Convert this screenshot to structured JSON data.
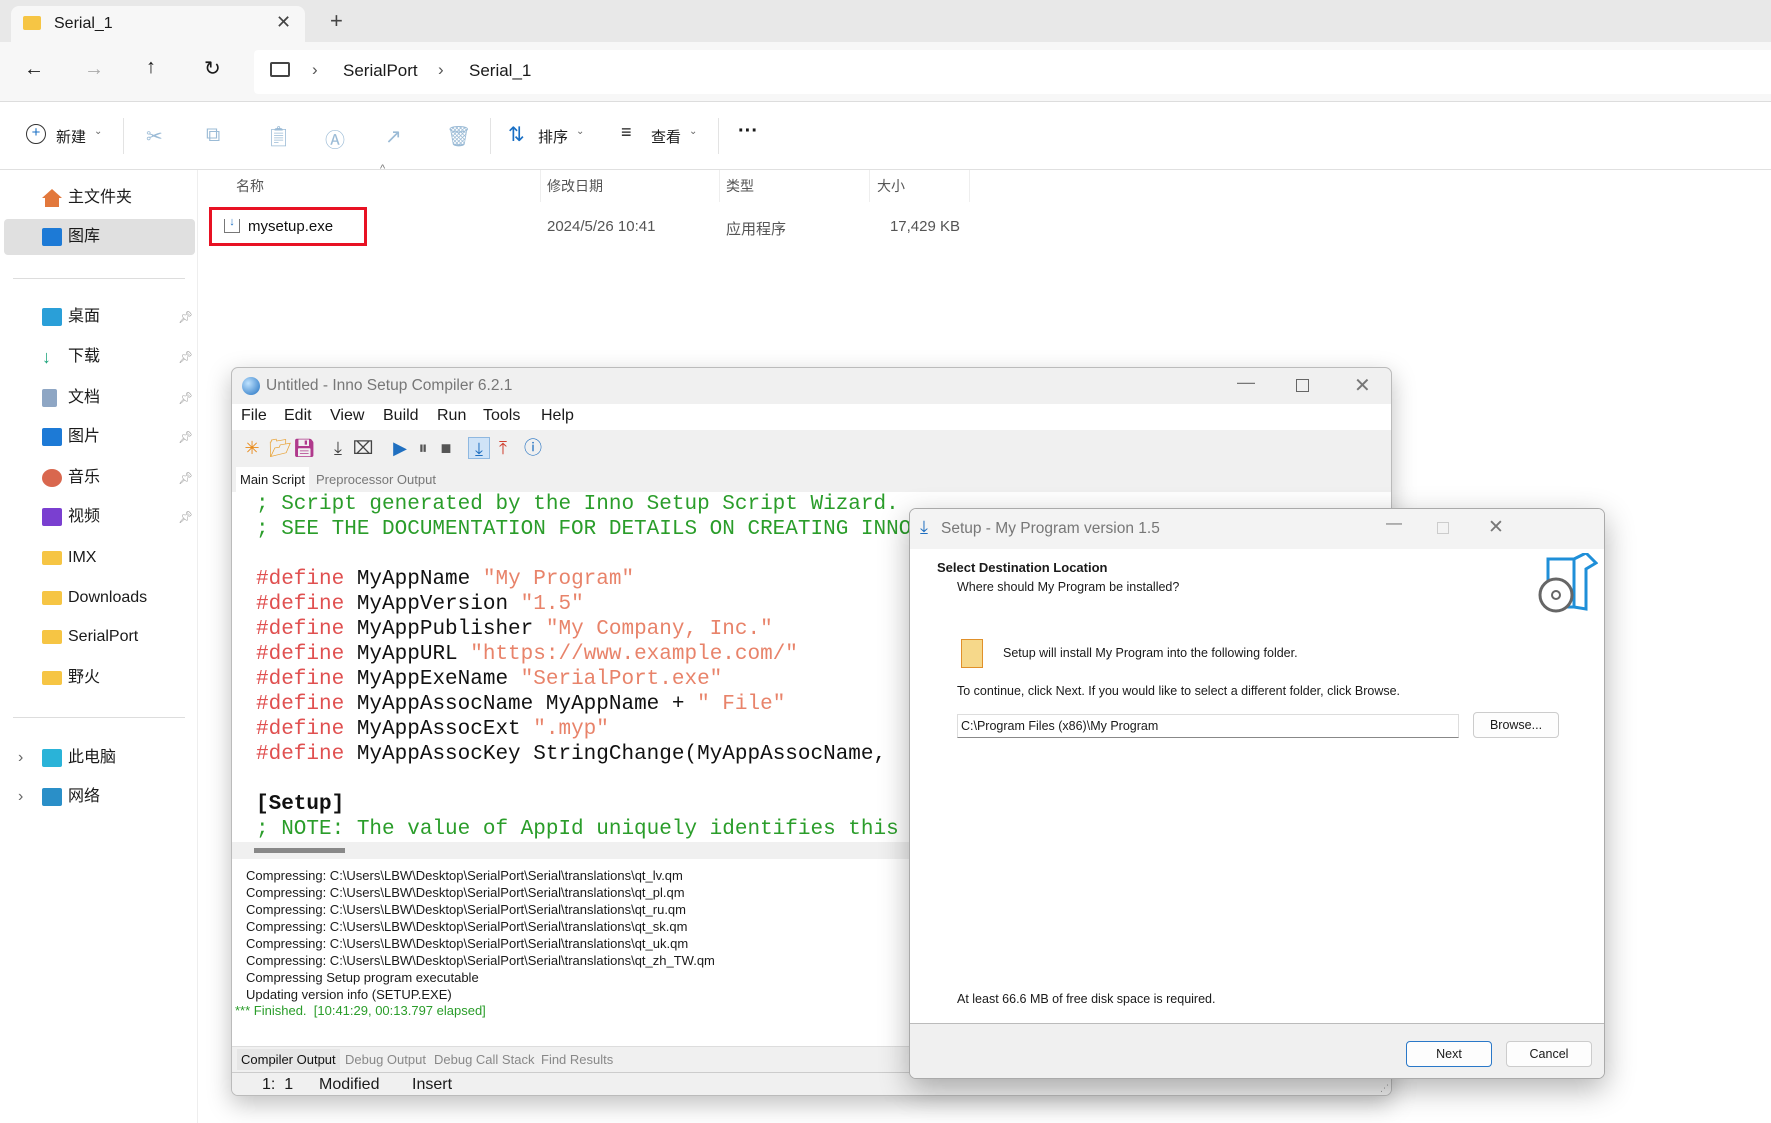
{
  "explorer": {
    "tab_title": "Serial_1",
    "breadcrumb": [
      "SerialPort",
      "Serial_1"
    ],
    "toolbar": {
      "new": "新建",
      "sort": "排序",
      "view": "查看",
      "more": "···"
    },
    "sidebar": {
      "top": [
        {
          "label": "主文件夹",
          "icon": "home-icon"
        },
        {
          "label": "图库",
          "icon": "gallery-icon",
          "selected": true
        }
      ],
      "quick": [
        {
          "label": "桌面",
          "icon": "desktop-icon",
          "pinned": true
        },
        {
          "label": "下载",
          "icon": "download-icon",
          "pinned": true
        },
        {
          "label": "文档",
          "icon": "documents-icon",
          "pinned": true
        },
        {
          "label": "图片",
          "icon": "pictures-icon",
          "pinned": true
        },
        {
          "label": "音乐",
          "icon": "music-icon",
          "pinned": true
        },
        {
          "label": "视频",
          "icon": "videos-icon",
          "pinned": true
        },
        {
          "label": "IMX",
          "icon": "folder-icon"
        },
        {
          "label": "Downloads",
          "icon": "folder-icon"
        },
        {
          "label": "SerialPort",
          "icon": "folder-icon"
        },
        {
          "label": "野火",
          "icon": "folder-icon"
        }
      ],
      "bottom": [
        {
          "label": "此电脑",
          "icon": "pc-icon"
        },
        {
          "label": "网络",
          "icon": "network-icon"
        }
      ]
    },
    "columns": [
      "名称",
      "修改日期",
      "类型",
      "大小"
    ],
    "files": [
      {
        "name": "mysetup.exe",
        "date": "2024/5/26 10:41",
        "type": "应用程序",
        "size": "17,429 KB",
        "highlight_color": "#e81123"
      }
    ]
  },
  "inno": {
    "title": "Untitled - Inno Setup Compiler 6.2.1",
    "menu": [
      "File",
      "Edit",
      "View",
      "Build",
      "Run",
      "Tools",
      "Help"
    ],
    "tabs": [
      "Main Script",
      "Preprocessor Output"
    ],
    "code": [
      [
        {
          "c": "cm",
          "t": "; Script generated by the Inno Setup Script Wizard."
        }
      ],
      [
        {
          "c": "cm",
          "t": "; SEE THE DOCUMENTATION FOR DETAILS ON CREATING INNO SETUP SCRIPT FILES!"
        }
      ],
      [],
      [
        {
          "c": "df",
          "t": "#define "
        },
        {
          "c": "nm",
          "t": "MyAppName "
        },
        {
          "c": "st",
          "t": "\"My Program\""
        }
      ],
      [
        {
          "c": "df",
          "t": "#define "
        },
        {
          "c": "nm",
          "t": "MyAppVersion "
        },
        {
          "c": "st",
          "t": "\"1.5\""
        }
      ],
      [
        {
          "c": "df",
          "t": "#define "
        },
        {
          "c": "nm",
          "t": "MyAppPublisher "
        },
        {
          "c": "st",
          "t": "\"My Company, Inc.\""
        }
      ],
      [
        {
          "c": "df",
          "t": "#define "
        },
        {
          "c": "nm",
          "t": "MyAppURL "
        },
        {
          "c": "st",
          "t": "\"https://www.example.com/\""
        }
      ],
      [
        {
          "c": "df",
          "t": "#define "
        },
        {
          "c": "nm",
          "t": "MyAppExeName "
        },
        {
          "c": "st",
          "t": "\"SerialPort.exe\""
        }
      ],
      [
        {
          "c": "df",
          "t": "#define "
        },
        {
          "c": "nm",
          "t": "MyAppAssocName MyAppName + "
        },
        {
          "c": "st",
          "t": "\" File\""
        }
      ],
      [
        {
          "c": "df",
          "t": "#define "
        },
        {
          "c": "nm",
          "t": "MyAppAssocExt "
        },
        {
          "c": "st",
          "t": "\".myp\""
        }
      ],
      [
        {
          "c": "df",
          "t": "#define "
        },
        {
          "c": "nm",
          "t": "MyAppAssocKey StringChange(MyAppAssocName, "
        }
      ],
      [],
      [
        {
          "c": "nm",
          "t": "[Setup]",
          "b": true
        }
      ],
      [
        {
          "c": "cm",
          "t": "; NOTE: The value of AppId uniquely identifies this application."
        }
      ]
    ],
    "output": [
      "Compressing: C:\\Users\\LBW\\Desktop\\SerialPort\\Serial\\translations\\qt_lv.qm",
      "Compressing: C:\\Users\\LBW\\Desktop\\SerialPort\\Serial\\translations\\qt_pl.qm",
      "Compressing: C:\\Users\\LBW\\Desktop\\SerialPort\\Serial\\translations\\qt_ru.qm",
      "Compressing: C:\\Users\\LBW\\Desktop\\SerialPort\\Serial\\translations\\qt_sk.qm",
      "Compressing: C:\\Users\\LBW\\Desktop\\SerialPort\\Serial\\translations\\qt_uk.qm",
      "Compressing: C:\\Users\\LBW\\Desktop\\SerialPort\\Serial\\translations\\qt_zh_TW.qm",
      "Compressing Setup program executable",
      "Updating version info (SETUP.EXE)"
    ],
    "finished": "*** Finished.  [10:41:29, 00:13.797 elapsed]",
    "output_tabs": [
      "Compiler Output",
      "Debug Output",
      "Debug Call Stack",
      "Find Results"
    ],
    "status": {
      "position": "1:  1",
      "modified": "Modified",
      "mode": "Insert"
    }
  },
  "setup": {
    "title": "Setup - My Program version 1.5",
    "heading": "Select Destination Location",
    "subheading": "Where should My Program be installed?",
    "info": "Setup will install My Program into the following folder.",
    "instruction": "To continue, click Next. If you would like to select a different folder, click Browse.",
    "path": "C:\\Program Files (x86)\\My Program",
    "browse": "Browse...",
    "disk_space": "At least 66.6 MB of free disk space is required.",
    "next": "Next",
    "cancel": "Cancel"
  }
}
